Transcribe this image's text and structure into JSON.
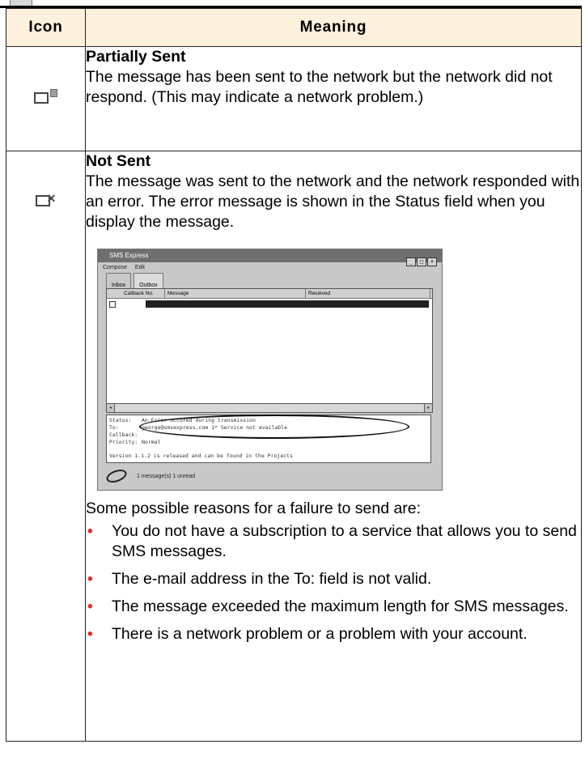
{
  "table": {
    "header_icon": "Icon",
    "header_meaning": "Meaning"
  },
  "rows": [
    {
      "icon": "partially-sent-icon",
      "title": "Partially Sent",
      "description": "The message has been sent to the network but the network did not respond. (This may indicate a network problem.)"
    },
    {
      "icon": "not-sent-icon",
      "title": "Not Sent",
      "description": "The message was sent to the network and the network responded with an error. The error message is shown in the Status field when you display the message."
    }
  ],
  "screenshot": {
    "window_title": "SMS Express",
    "menu": [
      "Compose",
      "Edit"
    ],
    "tabs": [
      "Inbox",
      "Outbox"
    ],
    "columns": [
      "",
      "Callback No.",
      "Message",
      "Received"
    ],
    "detail_labels": [
      "Status:",
      "To:",
      "Callback:",
      "Priority:"
    ],
    "detail_values": [
      "An Error occured during transmission",
      "george@smsexpress.com 1* Service not available",
      "",
      "Normal"
    ],
    "detail_footer": "Version 1.1.2 is released and can be found in the Projects",
    "status_text": "1 message(s) 1 unread"
  },
  "failure": {
    "intro": "Some possible reasons for a failure to send are:",
    "reasons": [
      "You do not have a subscription to a service that allows you to send SMS messages.",
      "The e-mail address in the To: field is not valid.",
      "The message exceeded the maximum length for SMS messages.",
      "There is a network problem or a problem with your account."
    ]
  }
}
